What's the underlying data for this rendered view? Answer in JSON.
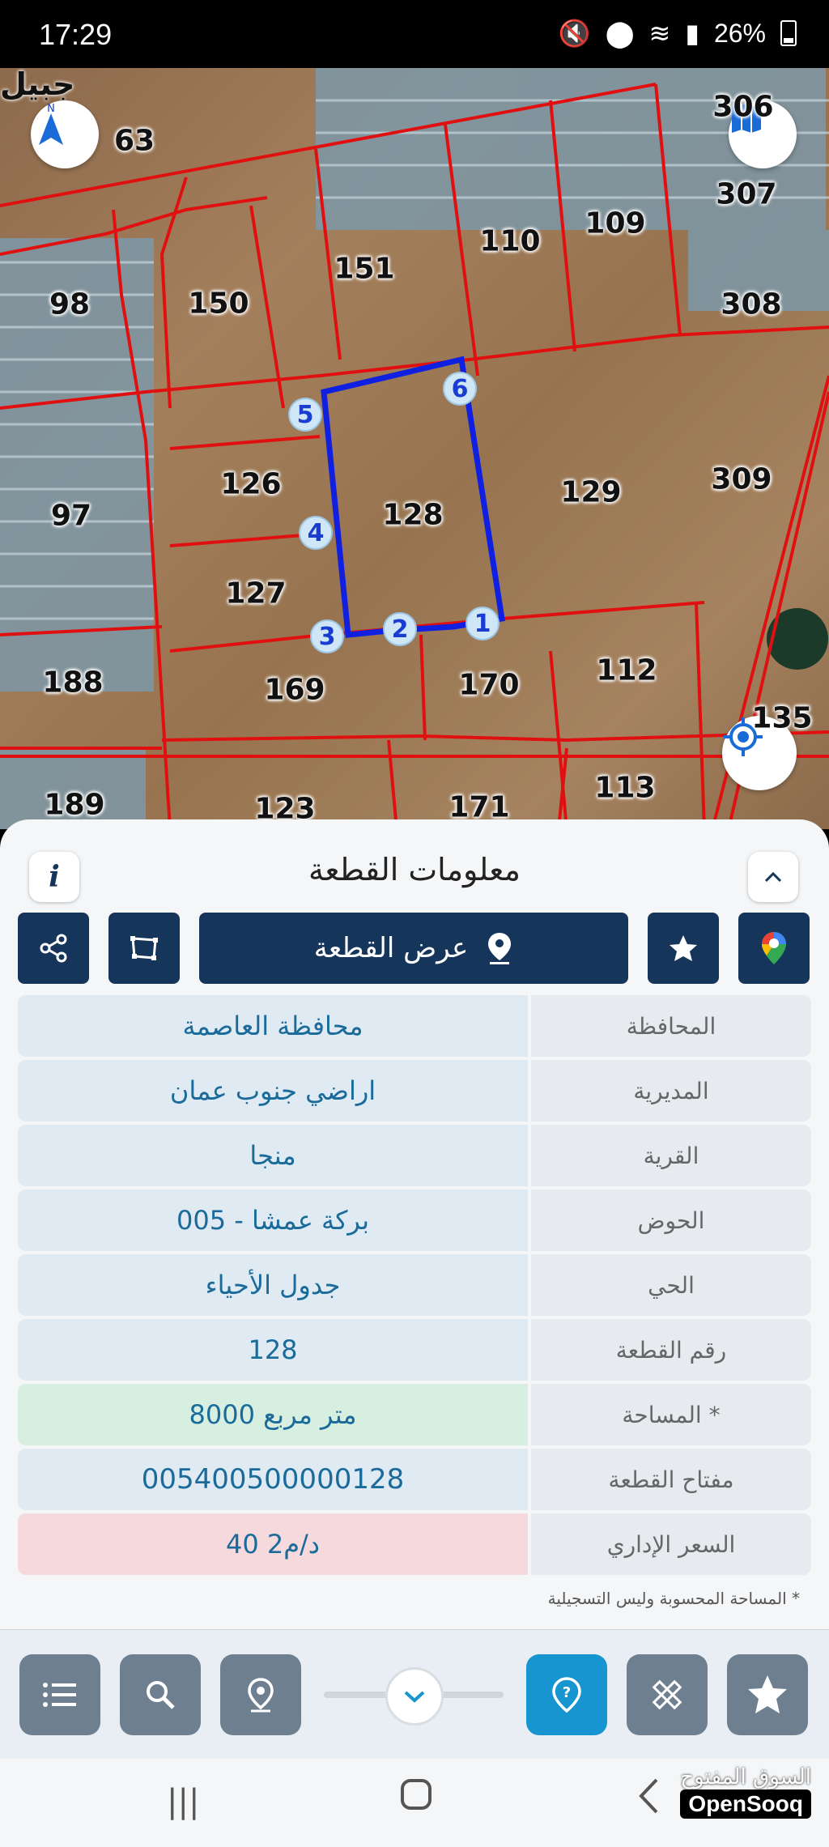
{
  "status_bar": {
    "time": "17:29",
    "battery": "26%"
  },
  "map": {
    "village_label": "جبيل",
    "parcels": [
      {
        "id": "63",
        "label": "63"
      },
      {
        "id": "306",
        "label": "306"
      },
      {
        "id": "307",
        "label": "307"
      },
      {
        "id": "151",
        "label": "151"
      },
      {
        "id": "110",
        "label": "110"
      },
      {
        "id": "109",
        "label": "109"
      },
      {
        "id": "98",
        "label": "98"
      },
      {
        "id": "150",
        "label": "150"
      },
      {
        "id": "308",
        "label": "308"
      },
      {
        "id": "126",
        "label": "126"
      },
      {
        "id": "128",
        "label": "128"
      },
      {
        "id": "129",
        "label": "129"
      },
      {
        "id": "309",
        "label": "309"
      },
      {
        "id": "97",
        "label": "97"
      },
      {
        "id": "127",
        "label": "127"
      },
      {
        "id": "188",
        "label": "188"
      },
      {
        "id": "169",
        "label": "169"
      },
      {
        "id": "170",
        "label": "170"
      },
      {
        "id": "112",
        "label": "112"
      },
      {
        "id": "135",
        "label": "135"
      },
      {
        "id": "113",
        "label": "113"
      },
      {
        "id": "189",
        "label": "189"
      },
      {
        "id": "123",
        "label": "123"
      },
      {
        "id": "171",
        "label": "171"
      }
    ],
    "vertices": [
      "1",
      "2",
      "3",
      "4",
      "5",
      "6"
    ],
    "colors": {
      "boundary": "#e01010",
      "selected": "#1020e0"
    }
  },
  "panel": {
    "title": "معلومات القطعة",
    "view_parcel_label": "عرض القطعة",
    "rows": [
      {
        "label": "المحافظة",
        "value": "محافظة العاصمة",
        "tone": "blue"
      },
      {
        "label": "المديرية",
        "value": "اراضي جنوب عمان",
        "tone": "blue"
      },
      {
        "label": "القرية",
        "value": "منجا",
        "tone": "blue"
      },
      {
        "label": "الحوض",
        "value": "بركة عمشا - 005",
        "tone": "blue"
      },
      {
        "label": "الحي",
        "value": "جدول الأحياء",
        "tone": "blue"
      },
      {
        "label": "رقم القطعة",
        "value": "128",
        "tone": "blue"
      },
      {
        "label": "المساحة *",
        "value": "8000  متر مربع",
        "tone": "green"
      },
      {
        "label": "مفتاح القطعة",
        "value": "005400500000128",
        "tone": "blue"
      },
      {
        "label": "السعر الإداري",
        "value": "40 د/م2",
        "tone": "red"
      }
    ],
    "footnote": "* المساحة المحسوبة وليس التسجيلية"
  },
  "watermark": {
    "arabic": "السوق المفتوح",
    "english": "OpenSooq"
  }
}
